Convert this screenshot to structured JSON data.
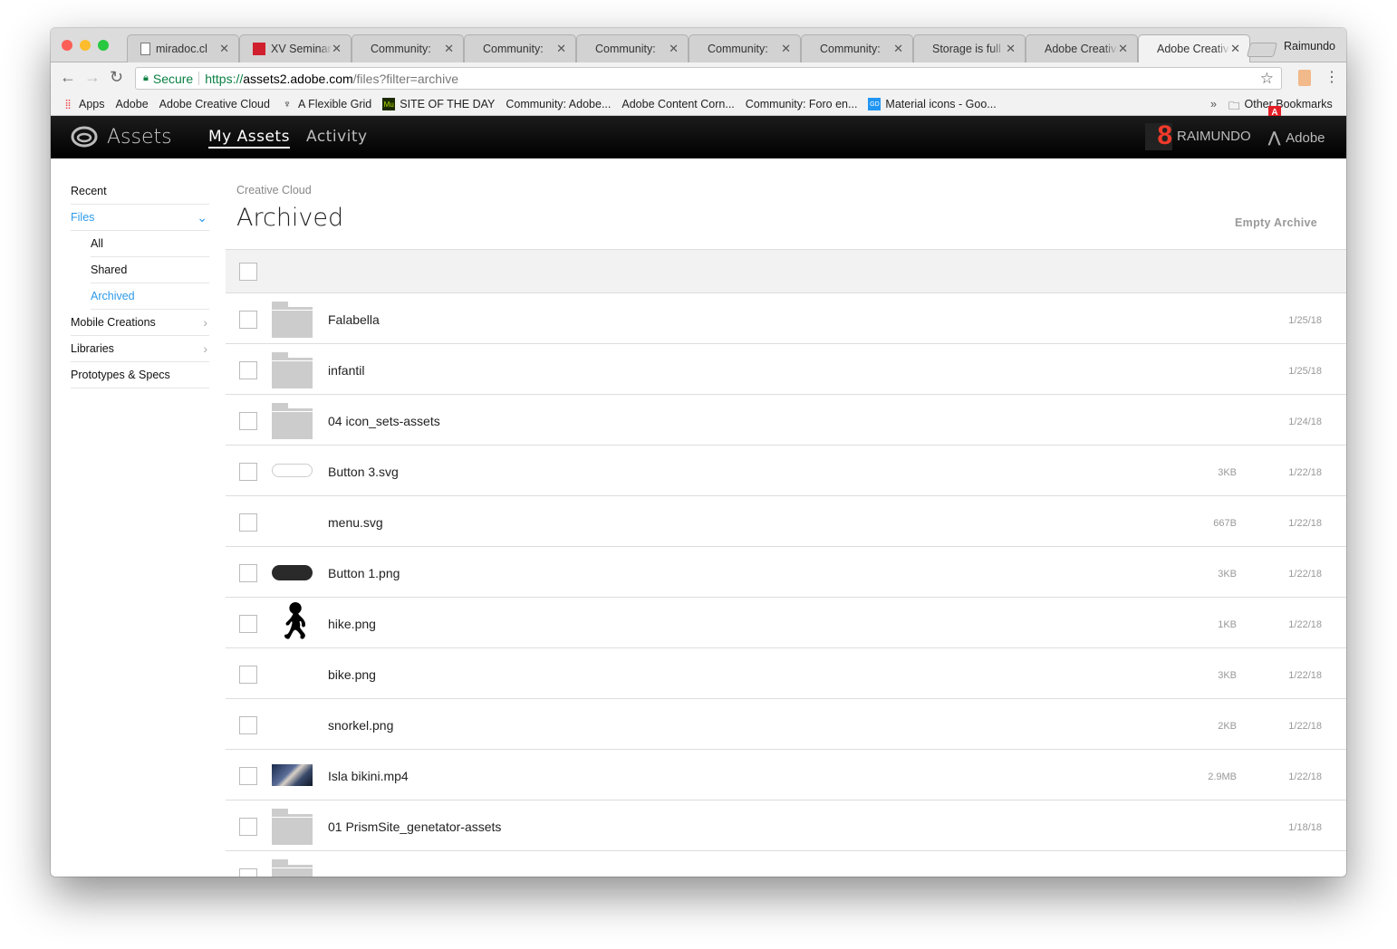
{
  "browser": {
    "tabs": [
      {
        "title": "miradoc.cl",
        "icon": "document-icon"
      },
      {
        "title": "XV Seminario",
        "icon": "red-square-icon"
      },
      {
        "title": "Community:",
        "icon": "adobe-icon"
      },
      {
        "title": "Community:",
        "icon": "adobe-icon"
      },
      {
        "title": "Community:",
        "icon": "adobe-icon"
      },
      {
        "title": "Community:",
        "icon": "adobe-icon"
      },
      {
        "title": "Community:",
        "icon": "adobe-icon"
      },
      {
        "title": "Storage is full",
        "icon": "adobe-icon"
      },
      {
        "title": "Adobe Creative",
        "icon": "adobe-icon"
      },
      {
        "title": "Adobe Creative",
        "icon": "adobe-icon",
        "active": true
      }
    ],
    "close_glyph": "✕",
    "profile": "Raimundo",
    "secure_label": "Secure",
    "url": {
      "scheme": "https://",
      "domain": "assets2.adobe.com",
      "path": "/files?filter=archive"
    },
    "bookmarks": [
      {
        "label": "Apps",
        "icon": "apps-grid-icon"
      },
      {
        "label": "Adobe",
        "icon": "adobe-icon"
      },
      {
        "label": "Adobe Creative Cloud",
        "icon": "adobe-icon"
      },
      {
        "label": "A Flexible Grid",
        "icon": "grid-logo-icon"
      },
      {
        "label": "SITE OF THE DAY",
        "icon": "muse-icon"
      },
      {
        "label": "Community: Adobe...",
        "icon": "adobe-icon"
      },
      {
        "label": "Adobe Content Corn...",
        "icon": "adobe-icon"
      },
      {
        "label": "Community: Foro en...",
        "icon": "adobe-icon"
      },
      {
        "label": "Material icons - Goo...",
        "icon": "gd-icon"
      }
    ],
    "overflow": "»",
    "other_bookmarks": "Other Bookmarks"
  },
  "app": {
    "title": "Assets",
    "nav": [
      {
        "label": "My Assets",
        "active": true
      },
      {
        "label": "Activity"
      }
    ],
    "user": "RAIMUNDO",
    "brand": "Adobe",
    "avatar_glyph": "8"
  },
  "sidebar": {
    "items": [
      {
        "label": "Recent"
      },
      {
        "label": "Files",
        "active": true,
        "expanded": true
      },
      {
        "label": "All",
        "sub": true
      },
      {
        "label": "Shared",
        "sub": true
      },
      {
        "label": "Archived",
        "sub": true,
        "active": true
      },
      {
        "label": "Mobile Creations",
        "arrow": true
      },
      {
        "label": "Libraries",
        "arrow": true
      },
      {
        "label": "Prototypes & Specs"
      }
    ]
  },
  "content": {
    "breadcrumb": "Creative Cloud",
    "title": "Archived",
    "empty_archive": "Empty Archive",
    "files": [
      {
        "name": "Falabella",
        "size": "",
        "date": "1/25/18",
        "thumb": "folder"
      },
      {
        "name": "infantil",
        "size": "",
        "date": "1/25/18",
        "thumb": "folder"
      },
      {
        "name": "04 icon_sets-assets",
        "size": "",
        "date": "1/24/18",
        "thumb": "folder"
      },
      {
        "name": "Button 3.svg",
        "size": "3KB",
        "date": "1/22/18",
        "thumb": "pill-o"
      },
      {
        "name": "menu.svg",
        "size": "667B",
        "date": "1/22/18",
        "thumb": ""
      },
      {
        "name": "Button 1.png",
        "size": "3KB",
        "date": "1/22/18",
        "thumb": "pill-b"
      },
      {
        "name": "hike.png",
        "size": "1KB",
        "date": "1/22/18",
        "thumb": "hiker"
      },
      {
        "name": "bike.png",
        "size": "3KB",
        "date": "1/22/18",
        "thumb": ""
      },
      {
        "name": "snorkel.png",
        "size": "2KB",
        "date": "1/22/18",
        "thumb": ""
      },
      {
        "name": "Isla bikini.mp4",
        "size": "2.9MB",
        "date": "1/22/18",
        "thumb": "video"
      },
      {
        "name": "01 PrismSite_genetator-assets",
        "size": "",
        "date": "1/18/18",
        "thumb": "folder"
      },
      {
        "name": "",
        "size": "",
        "date": "",
        "thumb": "folder"
      }
    ]
  },
  "colors": {
    "accent": "#2d9ae8",
    "header_bg": "#000000",
    "secure": "#0b8043"
  }
}
